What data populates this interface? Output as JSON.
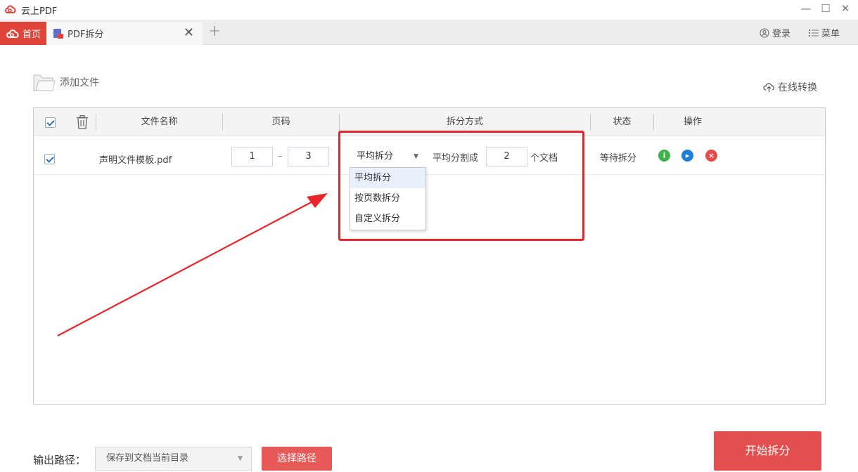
{
  "app": {
    "title": "云上PDF"
  },
  "window": {
    "minimize": "—",
    "maximize": "☐",
    "close": "✕"
  },
  "tabs": {
    "home_label": "首页",
    "split_label": "PDF拆分",
    "close_glyph": "✕",
    "add_glyph": "+"
  },
  "header": {
    "login_label": "登录",
    "menu_label": "菜单"
  },
  "toolbar": {
    "add_file_label": "添加文件",
    "online_convert_label": "在线转换"
  },
  "table": {
    "columns": {
      "file_name": "文件名称",
      "pages": "页码",
      "split_mode": "拆分方式",
      "status": "状态",
      "actions": "操作"
    },
    "rows": [
      {
        "checked": true,
        "file_name": "声明文件模板.pdf",
        "page_from": "1",
        "page_sep": "–",
        "page_to": "3",
        "split_mode": "平均拆分",
        "avg_prefix": "平均分割成",
        "avg_count": "2",
        "avg_suffix": "个文档",
        "status": "等待拆分"
      }
    ]
  },
  "split_dropdown": {
    "options": [
      "平均拆分",
      "按页数拆分",
      "自定义拆分"
    ],
    "selected": "平均拆分"
  },
  "output": {
    "label": "输出路径：",
    "path_value": "保存到文档当前目录",
    "choose_label": "选择路径"
  },
  "start_button_label": "开始拆分",
  "colors": {
    "accent_red": "#e0453a",
    "annotation_red": "#e8262b",
    "info_green": "#3cb44a",
    "play_blue": "#1f7fd8",
    "delete_red": "#e84a4a"
  }
}
